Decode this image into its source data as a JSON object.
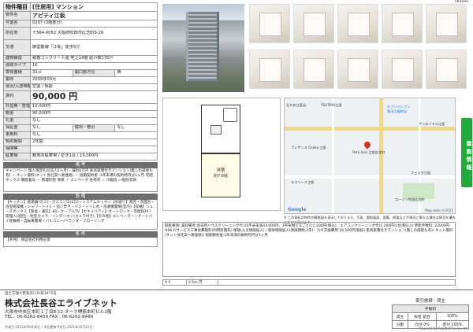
{
  "top_code": "888888",
  "spec": {
    "title_key": "物件種目",
    "title_val": "[住居用] マンション",
    "rows": [
      {
        "k": "物件名",
        "v": "アピティ江坂"
      },
      {
        "k": "号室名",
        "v": "0207 (3階部分)"
      },
      {
        "k": "所在地",
        "v": "〒564-0052 大阪府吹田市広芝町6-26"
      },
      {
        "k": "交通",
        "v": "御堂筋線「江坂」徒歩5分"
      },
      {
        "k": "建物構造",
        "v": "鉄筋コンクリート造 地上14階 総戸数130戸"
      },
      {
        "k": "間取タイプ",
        "v": "1K"
      }
    ],
    "area_key": "専有面積",
    "area_val": "32㎡",
    "window_key": "開口部方位",
    "window_val": "西",
    "year_key": "築年",
    "year_val": "2009年09月",
    "status_key": "現況/入居時期",
    "status_val": "空室 / 相談",
    "rent_key": "賃料",
    "rent_val": "90,000 円",
    "rows2": [
      {
        "k": "共益費・管理費",
        "v": "10,000円"
      },
      {
        "k": "敷金",
        "v": "90,000円"
      },
      {
        "k": "礼金",
        "v": "なし"
      }
    ],
    "hosho_key": "保証金",
    "hosho_val": "なし",
    "shokyaku_key": "償却・敷引",
    "shokyaku_val": "なし",
    "rows3": [
      {
        "k": "更新料",
        "v": "なし"
      },
      {
        "k": "契約期間",
        "v": "2年間"
      },
      {
        "k": "保険等",
        "v": ""
      },
      {
        "k": "駐車場",
        "v": "敷地内駐車場 / 空き1台 / 19,000円"
      }
    ],
    "remarks_label": "備 考",
    "remarks": "キャンペーン 個人限定礼0(法人2ヶ月)・賃料6万円 家具家電付きマンション(無しの部屋も有) ・ ネット無料(ネット会社案へ要連絡) ・ 短期契約者 :1年未満の契約時月分1ヶ月 宅配ボックス 機能着号 ・ 管理形態 清掃 ・ エレベータ 各階有 ・ 冷暖房 一般防音床",
    "features_label": "設 備",
    "features": "【キッチン】給湯器(ガス)・ガスコンロ(2口)・システムキッチン【水廻り】風呂・洗面台・浴室乾燥機・シャワートイレ・追い焚き・バス・トイレ別・洗濯機置場(室内)【収納】シューズボックス【放送・通信】BS・ケーブルTV【セキュリティ】オートロック・宅配BOX・管理人(巡回)・防犯カメラ・インターホン(カメラ付き)【その他】エレベーター・オートバイ駐輪場・自転車置場・バルコニー/ベランダ・フローリング",
    "conditions_label": "条 件",
    "conditions": "【条件】 保証会社利用必須"
  },
  "floorplan": {
    "room_label": "洋室",
    "room_size": "約7.6帖"
  },
  "map": {
    "labels": [
      "なか卯江坂店",
      "TSUTAYA江坂",
      "セブンイレブン",
      "吹田江坂町店",
      "サンロイヤル江坂",
      "プレサンス Osaka 江坂",
      "Park Axis 江坂広芝町",
      "エスリード江坂",
      "フェスタ江坂",
      "ローソン吹田広芝町",
      "Google",
      "Map data ©2021"
    ],
    "note": "※ この資料は物件の概略図を表示しております。写真、間取図面、設備、概要などが現況と異なる場合は現況を優先とさせて頂きます。"
  },
  "side_tab": "業務情報",
  "notes": "取扱事項: 賃料備考:退去時ハウスクリーニング代:20平米未満33,000円、1平米増えるごとに1,100円(税込)、エアコンクリーニング代(1,200円/1台(税込))/ 更新手数料: 22000円 ※Wi-Fiサービス工事会費無料(利用料無料) 保険(火災保険加入) / 家財保険加入(保険期間:2年)・カギ交換費用:16,500円(税抜) 家具家電付きマンション(無しの部屋も有)/ ネット無料(ネット会社案へ要連絡)/ 短期解約金:1年未満の解約時月分1ヶ月",
  "scale": [
    "A 0",
    "2.5m 円"
  ],
  "footer": {
    "license": "国土交通大臣免許(10)第3475号",
    "company": "株式会社長谷エライブネット",
    "address": "大阪市中央区本町１丁目8-12 オーク堺筋本町ビル2階",
    "tel": "TEL : 06-6262-8450   FAX : 06-6262-8480",
    "stamp": "作成日:2021年09月26日 / 次回更新予定日:2021年10月11日",
    "powered": "Powered by RealNetPro co., ltd."
  },
  "torihiki": {
    "head": "取引態様 : 貸主",
    "fee_label": "手数料",
    "rows": [
      [
        "貸主",
        "負担 割合",
        "100%"
      ],
      [
        "分配",
        "元付 0%",
        "客付 100%"
      ]
    ]
  }
}
